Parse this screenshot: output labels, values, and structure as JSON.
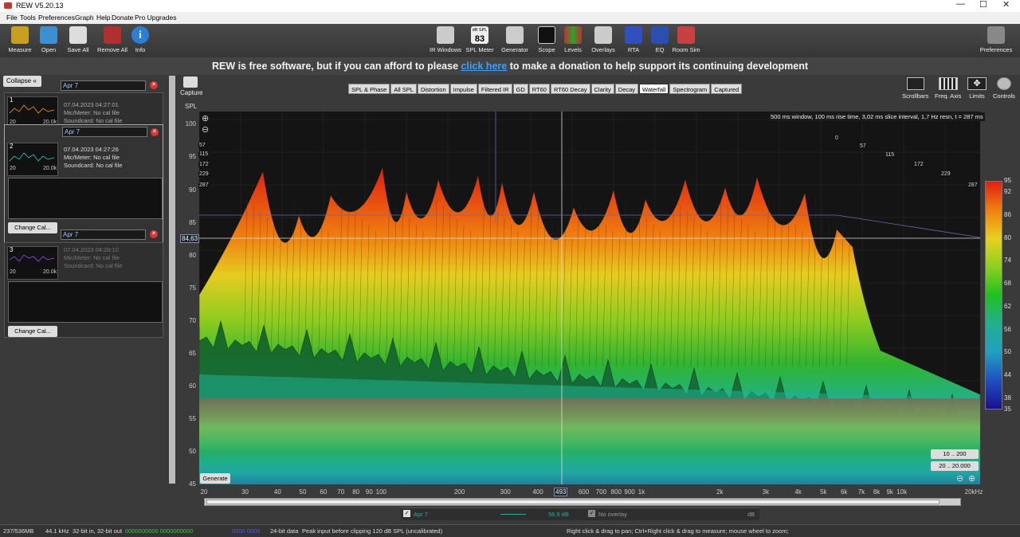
{
  "window": {
    "title": "REW V5.20.13"
  },
  "menu": [
    "File",
    "Tools",
    "Preferences",
    "Graph",
    "Help",
    "Donate",
    "Pro Upgrades"
  ],
  "toolbar_left": [
    {
      "label": "Measure",
      "icon": "measure-icon"
    },
    {
      "label": "Open",
      "icon": "folder-icon"
    },
    {
      "label": "Save All",
      "icon": "save-icon"
    },
    {
      "label": "Remove All",
      "icon": "remove-icon"
    },
    {
      "label": "Info",
      "icon": "info-icon"
    }
  ],
  "toolbar_center": [
    {
      "label": "IR Windows",
      "icon": "ir-windows-icon"
    },
    {
      "label": "SPL Meter",
      "icon": "spl-meter-icon",
      "badge_top": "dB SPL",
      "badge_value": "83"
    },
    {
      "label": "Generator",
      "icon": "generator-icon"
    },
    {
      "label": "Scope",
      "icon": "scope-icon"
    },
    {
      "label": "Levels",
      "icon": "levels-icon"
    },
    {
      "label": "Overlays",
      "icon": "overlays-icon"
    },
    {
      "label": "RTA",
      "icon": "rta-icon"
    },
    {
      "label": "EQ",
      "icon": "eq-icon"
    },
    {
      "label": "Room Sim",
      "icon": "room-sim-icon"
    }
  ],
  "toolbar_right": {
    "label": "Preferences",
    "icon": "wrench-icon"
  },
  "banner": {
    "before": "REW is free software, but if you can afford to please",
    "link": "click here",
    "after": "to make a donation to help support its continuing development"
  },
  "left_panel": {
    "collapse_label": "Collapse",
    "measurements": [
      {
        "index": "1",
        "name": "Apr 7",
        "date": "07.04.2023 04:27:01",
        "mic": "Mic/Meter: No cal file",
        "soundcard": "Soundcard: No cal file",
        "lo": "20",
        "hi": "20.0k",
        "trace_color": "#d08020"
      },
      {
        "index": "2",
        "name": "Apr 7",
        "date": "07.04.2023 04:27:26",
        "mic": "Mic/Meter: No cal file",
        "soundcard": "Soundcard: No cal file",
        "lo": "20",
        "hi": "20.0k",
        "trace_color": "#20b0a0",
        "cal_button": "Change Cal..."
      },
      {
        "index": "3",
        "name": "Apr 7",
        "date": "07.04.2023 04:28:10",
        "mic": "Mic/Meter: No cal file",
        "soundcard": "Soundcard: No cal file",
        "lo": "20",
        "hi": "20.0k",
        "trace_color": "#8040d0",
        "cal_button": "Change Cal..."
      }
    ]
  },
  "capture": {
    "label": "Capture"
  },
  "tabs": [
    {
      "label": "SPL & Phase",
      "active": false
    },
    {
      "label": "All SPL",
      "active": false
    },
    {
      "label": "Distortion",
      "active": false
    },
    {
      "label": "Impulse",
      "active": false
    },
    {
      "label": "Filtered IR",
      "active": false
    },
    {
      "label": "GD",
      "active": false
    },
    {
      "label": "RT60",
      "active": false
    },
    {
      "label": "RT60 Decay",
      "active": false
    },
    {
      "label": "Clarity",
      "active": false
    },
    {
      "label": "Decay",
      "active": false
    },
    {
      "label": "Waterfall",
      "active": true
    },
    {
      "label": "Spectrogram",
      "active": false
    },
    {
      "label": "Captured",
      "active": false
    }
  ],
  "right_tools": [
    {
      "label": "Scrollbars",
      "icon": "scrollbars-icon"
    },
    {
      "label": "Freq. Axis",
      "icon": "freq-axis-icon"
    },
    {
      "label": "Limits",
      "icon": "limits-icon"
    },
    {
      "label": "Controls",
      "icon": "gear-icon"
    }
  ],
  "chart_data": {
    "type": "waterfall",
    "ylabel": "SPL",
    "y_ticks": [
      "100",
      "95",
      "90",
      "85",
      "80",
      "75",
      "70",
      "65",
      "60",
      "55",
      "50",
      "45"
    ],
    "x_ticks": [
      "20",
      "30",
      "40",
      "50",
      "60",
      "70",
      "80",
      "90",
      "100",
      "200",
      "300",
      "400",
      "493",
      "600",
      "700",
      "800",
      "900",
      "1k",
      "2k",
      "3k",
      "4k",
      "5k",
      "6k",
      "7k",
      "8k",
      "9k",
      "10k",
      "20kHz"
    ],
    "x_scale": "log",
    "x_range": [
      20,
      20000
    ],
    "y_range": [
      45,
      102
    ],
    "cursor": {
      "x": "493",
      "y": "84,63"
    },
    "slice_info": "500 ms window, 100 ms rise time, 3,02 ms slice interval, 1,7 Hz resn, t = 287 ms",
    "time_labels_left": [
      "57",
      "115",
      "172",
      "229",
      "287"
    ],
    "time_labels_right": [
      "0",
      "57",
      "115",
      "172",
      "229",
      "287"
    ],
    "colorbar_ticks": [
      "95",
      "92",
      "86",
      "80",
      "74",
      "68",
      "62",
      "56",
      "50",
      "44",
      "38",
      "35"
    ],
    "range_buttons": [
      "10 .. 200",
      "20 .. 20.000"
    ],
    "generate_label": "Generate"
  },
  "legend": {
    "name": "Apr 7",
    "value": "56,9 dB",
    "overlay": "No overlay",
    "unit": "dB"
  },
  "status": {
    "memory": "237/536MB",
    "rate": "44.1 kHz",
    "bits": "32-bit in, 32-bit out",
    "meter1": "0000000000  0000000000",
    "meter2": "0000 0000",
    "data": "24-bit data",
    "peak": "Peak input before clipping 120 dB SPL (uncalibrated)",
    "hint": "Right click & drag to pan; Ctrl+Right click & drag to measure; mouse wheel to zoom;"
  }
}
